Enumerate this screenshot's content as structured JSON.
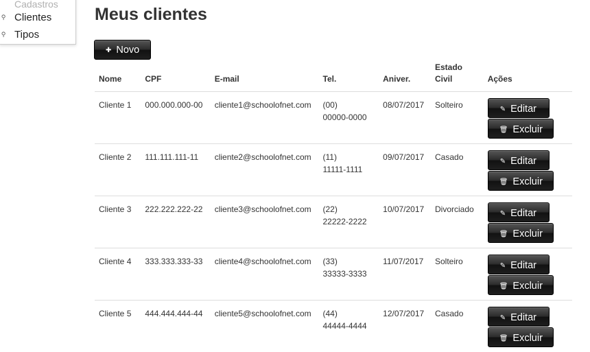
{
  "sidebar": {
    "header": "Cadastros",
    "items": [
      {
        "label": "Clientes",
        "icon": "user-icon"
      },
      {
        "label": "Tipos",
        "icon": "user-icon"
      }
    ]
  },
  "main": {
    "title": "Meus clientes",
    "new_button": {
      "icon": "plus-icon",
      "label": "Novo"
    }
  },
  "table": {
    "columns": [
      "Nome",
      "CPF",
      "E-mail",
      "Tel.",
      "Aniver.",
      "Estado Civil",
      "Ações"
    ],
    "edit_label": "Editar",
    "delete_label": "Excluir",
    "rows": [
      {
        "nome": "Cliente 1",
        "cpf": "000.000.000-00",
        "email": "cliente1@schoolofnet.com",
        "tel_ddd": "(00)",
        "tel_num": "00000-0000",
        "aniver": "08/07/2017",
        "estado_civil": "Solteiro"
      },
      {
        "nome": "Cliente 2",
        "cpf": "111.111.111-11",
        "email": "cliente2@schoolofnet.com",
        "tel_ddd": "(11)",
        "tel_num": "11111-1111",
        "aniver": "09/07/2017",
        "estado_civil": "Casado"
      },
      {
        "nome": "Cliente 3",
        "cpf": "222.222.222-22",
        "email": "cliente3@schoolofnet.com",
        "tel_ddd": "(22)",
        "tel_num": "22222-2222",
        "aniver": "10/07/2017",
        "estado_civil": "Divorciado"
      },
      {
        "nome": "Cliente 4",
        "cpf": "333.333.333-33",
        "email": "cliente4@schoolofnet.com",
        "tel_ddd": "(33)",
        "tel_num": "33333-3333",
        "aniver": "11/07/2017",
        "estado_civil": "Solteiro"
      },
      {
        "nome": "Cliente 5",
        "cpf": "444.444.444-44",
        "email": "cliente5@schoolofnet.com",
        "tel_ddd": "(44)",
        "tel_num": "44444-4444",
        "aniver": "12/07/2017",
        "estado_civil": "Casado"
      }
    ]
  }
}
